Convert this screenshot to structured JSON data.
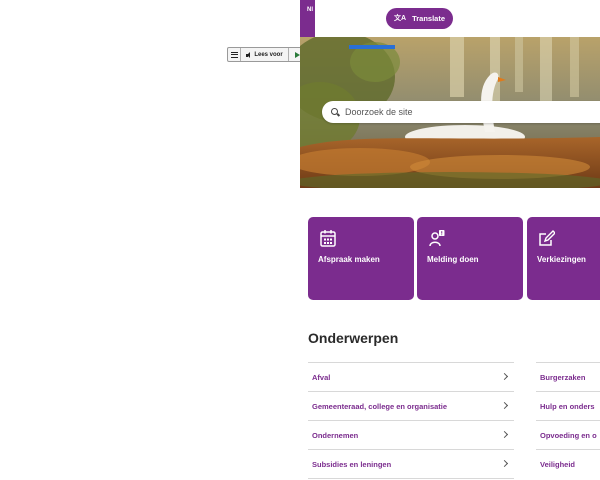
{
  "reader": {
    "listen_label": "Lees voor",
    "menu_icon": "menu-icon",
    "play_icon": "play-icon",
    "speaker_icon": "speaker-icon"
  },
  "topbar": {
    "language_tab": "Nl",
    "translate_label": "Translate",
    "translate_icon": "translate-icon"
  },
  "search": {
    "placeholder": "Doorzoek de site"
  },
  "tiles": [
    {
      "label": "Afspraak maken",
      "icon": "calendar-icon"
    },
    {
      "label": "Melding doen",
      "icon": "report-person-icon"
    },
    {
      "label": "Verkiezingen",
      "icon": "ballot-pen-icon"
    }
  ],
  "topics": {
    "heading": "Onderwerpen",
    "left": [
      "Afval",
      "Gemeenteraad, college en organisatie",
      "Ondernemen",
      "Subsidies en leningen"
    ],
    "right": [
      "Burgerzaken",
      "Hulp en onders",
      "Opvoeding en o",
      "Veiligheid"
    ]
  },
  "colors": {
    "brand": "#7b2c8e",
    "link": "#7b2c8e",
    "accent_blue": "#2a6fd6"
  }
}
